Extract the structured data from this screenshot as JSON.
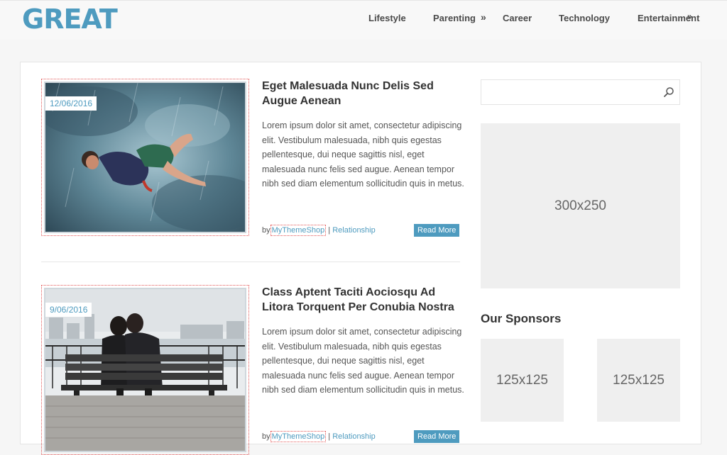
{
  "site": {
    "logo": "GREAT"
  },
  "nav": {
    "items": [
      "Lifestyle",
      "Parenting",
      "Career",
      "Technology",
      "Entertainment"
    ],
    "parenting_arrow": "»",
    "entertainment_arrow": "»"
  },
  "posts": [
    {
      "date": "12/06/2016",
      "title": "Eget Malesuada Nunc Delis Sed Augue Aenean",
      "excerpt": "Lorem ipsum dolor sit amet, consectetur adipiscing elit. Vestibulum malesuada, nibh quis egestas pellentesque, dui neque sagittis nisl, eget malesuada nunc felis sed augue. Aenean tempor nibh sed diam elementum sollicitudin quis in metus.",
      "by": "by",
      "author": "MyThemeShop",
      "separator": "|",
      "category": "Relationship",
      "read_more": "Read More"
    },
    {
      "date": "9/06/2016",
      "title": "Class Aptent Taciti Aociosqu Ad Litora Torquent Per Conubia Nostra",
      "excerpt": "Lorem ipsum dolor sit amet, consectetur adipiscing elit. Vestibulum malesuada, nibh quis egestas pellentesque, dui neque sagittis nisl, eget malesuada nunc felis sed augue. Aenean tempor nibh sed diam elementum sollicitudin quis in metus.",
      "by": "by",
      "author": "MyThemeShop",
      "separator": "|",
      "category": "Relationship",
      "read_more": "Read More"
    }
  ],
  "sidebar": {
    "search_placeholder": "",
    "ad_big": "300x250",
    "sponsors_title": "Our Sponsors",
    "ad_small_1": "125x125",
    "ad_small_2": "125x125"
  },
  "colors": {
    "accent": "#4e9bbf",
    "placeholder_bg": "#efefef"
  }
}
